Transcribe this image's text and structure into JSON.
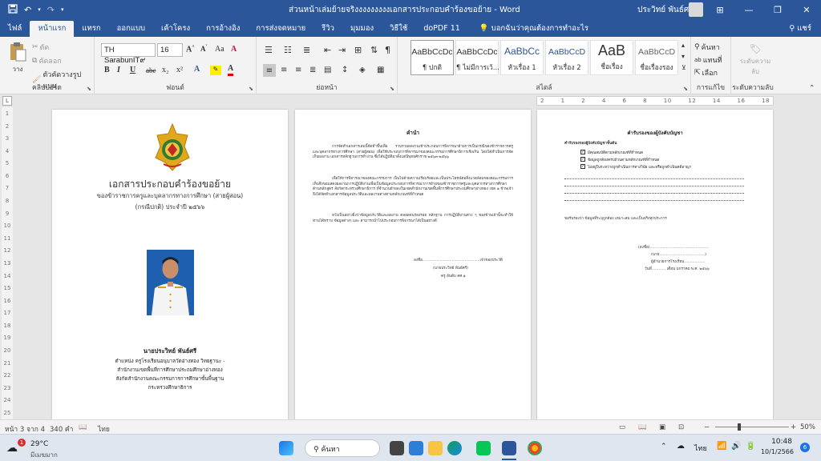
{
  "titlebar": {
    "doc_title": "ส่วนหน้าเล่มย้ายจริงงงงงงงงงเอกสารประกอบคำร้องขอย้าย - Word",
    "user": "ประวิทย์ พันธ์ศรี",
    "min": "—",
    "restore": "❐",
    "close": "✕",
    "ribbon_display": "⊞"
  },
  "tabs": [
    "ไฟล์",
    "หน้าแรก",
    "แทรก",
    "ออกแบบ",
    "เค้าโครง",
    "การอ้างอิง",
    "การส่งจดหมาย",
    "รีวิว",
    "มุมมอง",
    "วิธีใช้",
    "doPDF 11"
  ],
  "tell_me": "บอกฉันว่าคุณต้องการทำอะไร",
  "share": "แชร์",
  "ribbon": {
    "clipboard": {
      "label": "คลิปบอร์ด",
      "paste": "วาง",
      "cut": "ตัด",
      "copy": "คัดลอก",
      "format_painter": "ตัวคัดวางรูปแบบ"
    },
    "font": {
      "label": "ฟอนต์",
      "name": "TH SarabunIT๙",
      "size": "16",
      "buttons": [
        "B",
        "I",
        "U",
        "abc",
        "x₂",
        "x²"
      ]
    },
    "paragraph": {
      "label": "ย่อหน้า"
    },
    "styles": {
      "label": "สไตล์",
      "items": [
        {
          "sample": "AaBbCcDc",
          "name": "¶ ปกติ"
        },
        {
          "sample": "AaBbCcDc",
          "name": "¶ ไม่มีการเว้..."
        },
        {
          "sample": "AaBbCc",
          "name": "หัวเรื่อง 1"
        },
        {
          "sample": "AaBbCcD",
          "name": "หัวเรื่อง 2"
        },
        {
          "sample": "AaB",
          "name": "ชื่อเรื่อง"
        },
        {
          "sample": "AaBbCcD",
          "name": "ชื่อเรื่องรอง"
        }
      ]
    },
    "editing": {
      "label": "การแก้ไข",
      "find": "ค้นหา",
      "replace": "แทนที่",
      "select": "เลือก"
    },
    "sensitivity": {
      "label": "ระดับความลับ",
      "button": "ระดับความลับ"
    }
  },
  "ruler": {
    "corner": "L",
    "marks": [
      "2",
      "1",
      "2",
      "4",
      "6",
      "8",
      "10",
      "12",
      "14",
      "16",
      "18"
    ],
    "vertical_marks": [
      "1",
      "2",
      "3",
      "4",
      "5",
      "6",
      "7",
      "8",
      "9",
      "10",
      "11",
      "12",
      "13",
      "14",
      "15",
      "16",
      "17",
      "18",
      "19",
      "20",
      "21",
      "22",
      "23",
      "24",
      "25"
    ]
  },
  "page1": {
    "title": "เอกสารประกอบคำร้องขอย้าย",
    "subtitle": "ของข้าราชการครูและบุคลากรทางการศึกษา (สายผู้สอน)",
    "subtitle2": "(กรณีปกติ) ประจำปี  ๒๕๖๖",
    "name": "นายประวิทย์ พันธ์ศรี",
    "position": "ตำแหน่ง ครูโรงเรียนอนุบาลวัดอ่างทอง วิทยฐานะ -",
    "office1": "สำนักงานเขตพื้นที่การศึกษาประถมศึกษาอ่างทอง",
    "office2": "สังกัดสำนักงานคณะกรรมการการศึกษาขั้นพื้นฐาน",
    "ministry": "กระทรวงศึกษาธิการ"
  },
  "page2": {
    "heading": "คำนำ",
    "p1": "การจัดทำเอกสารเล่มนี้จัดทำขึ้นเพื่อ รวบรวมผลงานเข้าประกอบการพิจารณาย้ายการเป็นกรณีของข้าราชการครูและบุคลากรทางการศึกษา (สายผู้สอน) เพื่อใช้ประกอบการพิจารณาของคณะกรรมการศึกษาธิการเชิงเกิน โดยได้สำเนินการจัดเก็บผลงาน เอกสารหลักฐานการทำงาน ซึ่งได้ปฏิบัติมาตั้งแต่ปีพุทธศักราช ๒๕๖๓-๒๕๖๖",
    "p2": "เพื่อให้การพิจารณาของคณะกรรมการ เป็นไปด้วยความเรียบร้อยและเป็นประโยชน์ต่อสิ่งแวดล้อมของคณะกรรมการ เห็นจึงขอแสดงผลงานการปฏิบัติงานเพื่อเป็นข้อมูลประกอบการพิจารณาการย้ายของข้าราชการครูและบุคลากรทางการศึกษา ด้านหลักสูตร สังกัดกระทรวงศึกษาธิการ ที่จำนวนย้ายลงในเขตสำนักงานเขตพื้นที่การศึกษาประถมศึกษาอ่างทอง เขต ๑ ข้าพเจ้าจึงได้จัดทำเอกสารข้อมูลประวัติและผลงานทางตามหลักเกณฑ์ที่กำหนด",
    "p3": "หวังเป็นอย่างยิ่งว่าข้อมูลประวัติและผลงาน ตลอดจนร่องรอย หลักฐาน การปฏิบัติงานต่าง ๆ ของข้าพเจ้านี้จะทำให้ท่านได้ทราบ ข้อมูลต่างๆ และ สามารถนำไปประกอบการพิจารณาได้เป็นอย่างดี",
    "sign": "ลงชื่อ.................................................เจ้าของประวัติ",
    "sign_name": "(นายประวิทย์  พันธ์ศรี)",
    "sign_pos": "ครู อันดับ คศ.๑"
  },
  "page3": {
    "heading": "คำรับรองของผู้บังคับบัญชา",
    "sub": "คำรับรองของผู้บังคับบัญชาชั้นต้น",
    "checks": [
      "มีคุณสมบัติตามหลักเกณฑ์ที่กำหนด",
      "ข้อมูลถูกต้องครบถ้วนตามหลักเกณฑ์ที่กำหนด",
      "ไม่อยู่ในระหว่างถูกดำเนินการทางวินัย และหรือถูกดำเนินคดีอาญา"
    ],
    "cert": "ขอรับรองว่า ข้อมูลที่ระบุถูกต้อง เหมาะสม และเป็นจริงทุกประการ",
    "sign": "(ลงชื่อ)..................................................",
    "sign_name": "(นาย.......................................)",
    "sign_pos": "ผู้อำนวยการโรงเรียน..................",
    "date": "วันที่............ เดือน มกราคม พ.ศ. ๒๕๖๖"
  },
  "statusbar": {
    "page": "หน้า 3 จาก 4",
    "words": "340 คำ",
    "language": "ไทย",
    "zoom": "50%",
    "zoom_minus": "−",
    "zoom_plus": "+"
  },
  "taskbar": {
    "weather_temp": "29°C",
    "weather_desc": "มีเมฆมาก",
    "weather_badge": "1",
    "search": "ค้นหา",
    "lang": "ไทย",
    "time": "10:48",
    "date": "10/1/2566",
    "notif": "6"
  },
  "colors": {
    "word_blue": "#2b579a",
    "ribbon_bg": "#f3f3f3"
  }
}
